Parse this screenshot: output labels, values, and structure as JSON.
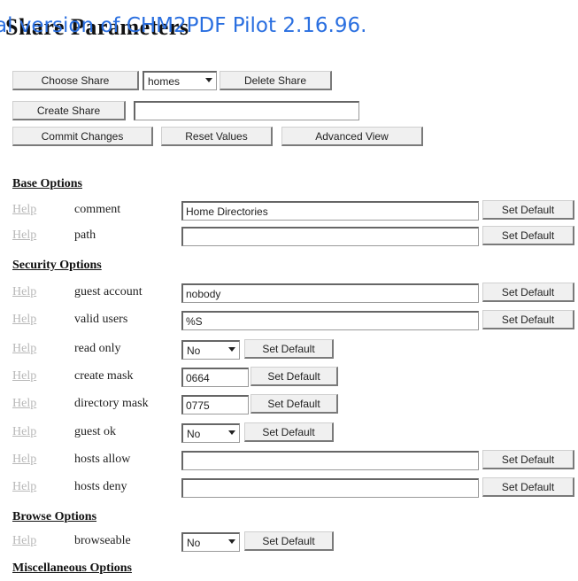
{
  "page": {
    "title": "Share Parameters",
    "watermark": "al version of CHM2PDF Pilot 2.16.96."
  },
  "toolbar": {
    "choose_share_label": "Choose Share",
    "share_select_value": "homes",
    "delete_share_label": "Delete Share",
    "create_share_label": "Create Share",
    "create_share_value": "",
    "commit_changes_label": "Commit Changes",
    "reset_values_label": "Reset Values",
    "advanced_view_label": "Advanced View"
  },
  "common": {
    "help_label": "Help",
    "set_default_label": "Set Default"
  },
  "sections": {
    "base": "Base Options",
    "security": "Security Options",
    "browse": "Browse Options",
    "misc": "Miscellaneous Options"
  },
  "params": {
    "comment": {
      "label": "comment",
      "value": "Home Directories"
    },
    "path": {
      "label": "path",
      "value": ""
    },
    "guest_account": {
      "label": "guest account",
      "value": "nobody"
    },
    "valid_users": {
      "label": "valid users",
      "value": "%S"
    },
    "read_only": {
      "label": "read only",
      "value": "No"
    },
    "create_mask": {
      "label": "create mask",
      "value": "0664"
    },
    "directory_mask": {
      "label": "directory mask",
      "value": "0775"
    },
    "guest_ok": {
      "label": "guest ok",
      "value": "No"
    },
    "hosts_allow": {
      "label": "hosts allow",
      "value": ""
    },
    "hosts_deny": {
      "label": "hosts deny",
      "value": ""
    },
    "browseable": {
      "label": "browseable",
      "value": "No"
    }
  }
}
